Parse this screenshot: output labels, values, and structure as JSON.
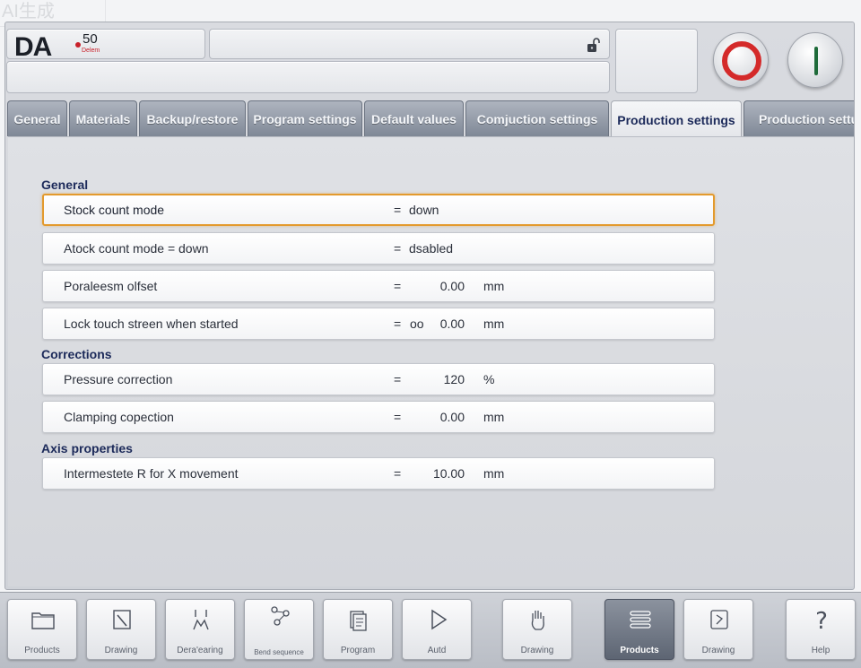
{
  "watermark": "AI生成",
  "header": {
    "logo_text": "DA",
    "logo_model": "50",
    "logo_subtitle": "Delem"
  },
  "tabs": [
    {
      "label": "General",
      "active": false
    },
    {
      "label": "Materials",
      "active": false
    },
    {
      "label": "Backup/restore",
      "active": false
    },
    {
      "label": "Program settings",
      "active": false
    },
    {
      "label": "Default values",
      "active": false
    },
    {
      "label": "Comjuction settings",
      "active": false
    },
    {
      "label": "Production settings",
      "active": true
    },
    {
      "label": "Production settu",
      "active": false
    }
  ],
  "sections": {
    "general": {
      "title": "General",
      "rows": [
        {
          "label": "Stock count mode",
          "eq": "=",
          "value": "down",
          "focused": true
        },
        {
          "label": "Atock count mode = down",
          "eq": "=",
          "value": "dsabled"
        },
        {
          "label": "Poraleesm olfset",
          "eq": "=",
          "number": "0.00",
          "unit": "mm"
        },
        {
          "label": "Lock touch streen when started",
          "eq": "=",
          "prefix": "oo",
          "number": "0.00",
          "unit": "mm"
        }
      ]
    },
    "corrections": {
      "title": "Corrections",
      "rows": [
        {
          "label": "Pressure correction",
          "eq": "=",
          "number": "120",
          "unit": "%"
        },
        {
          "label": "Clamping copection",
          "eq": "=",
          "number": "0.00",
          "unit": "mm"
        }
      ]
    },
    "axis": {
      "title": "Axis properties",
      "rows": [
        {
          "label": "Intermestete R for X movement",
          "eq": "=",
          "number": "10.00",
          "unit": "mm"
        }
      ]
    }
  },
  "bottom_buttons": [
    {
      "label": "Products",
      "icon": "folder-icon"
    },
    {
      "label": "Drawing",
      "icon": "pencil-icon"
    },
    {
      "label": "Dera'earing",
      "icon": "bend-icon"
    },
    {
      "label": "Bend sequence",
      "icon": "sequence-icon"
    },
    {
      "label": "Program",
      "icon": "program-icon"
    },
    {
      "label": "Autd",
      "icon": "play-icon"
    },
    {
      "label": "Drawing",
      "icon": "hand-icon"
    },
    {
      "label": "Products",
      "icon": "list-icon",
      "active": true
    },
    {
      "label": "Drawing",
      "icon": "drawing-icon"
    },
    {
      "label": "Help",
      "icon": "help-icon"
    }
  ],
  "colors": {
    "focus": "#e39a2d",
    "tab_active_text": "#1c2a5a",
    "stop_ring": "#d42a2a",
    "start_line": "#1f6b3a"
  }
}
